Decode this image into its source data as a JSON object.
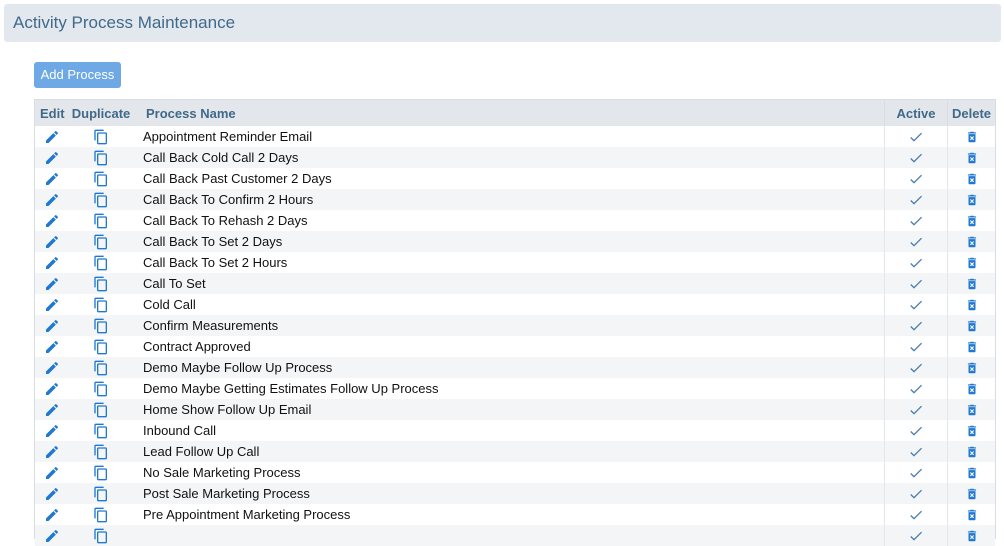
{
  "header": {
    "title": "Activity Process Maintenance"
  },
  "toolbar": {
    "add_label": "Add Process"
  },
  "table": {
    "columns": {
      "edit": "Edit",
      "duplicate": "Duplicate",
      "name": "Process Name",
      "active": "Active",
      "delete": "Delete"
    },
    "rows": [
      {
        "name": "Appointment Reminder Email",
        "active": true
      },
      {
        "name": "Call Back Cold Call 2 Days",
        "active": true
      },
      {
        "name": "Call Back Past Customer 2 Days",
        "active": true
      },
      {
        "name": "Call Back To Confirm 2 Hours",
        "active": true
      },
      {
        "name": "Call Back To Rehash 2 Days",
        "active": true
      },
      {
        "name": "Call Back To Set 2 Days",
        "active": true
      },
      {
        "name": "Call Back To Set 2 Hours",
        "active": true
      },
      {
        "name": "Call To Set",
        "active": true
      },
      {
        "name": "Cold Call",
        "active": true
      },
      {
        "name": "Confirm Measurements",
        "active": true
      },
      {
        "name": "Contract Approved",
        "active": true
      },
      {
        "name": "Demo Maybe Follow Up Process",
        "active": true
      },
      {
        "name": "Demo Maybe Getting Estimates Follow Up Process",
        "active": true
      },
      {
        "name": "Home Show Follow Up Email",
        "active": true
      },
      {
        "name": "Inbound Call",
        "active": true
      },
      {
        "name": "Lead Follow Up Call",
        "active": true
      },
      {
        "name": "No Sale Marketing Process",
        "active": true
      },
      {
        "name": "Post Sale Marketing Process",
        "active": true
      },
      {
        "name": "Pre Appointment Marketing Process",
        "active": true
      },
      {
        "name": "",
        "active": true
      }
    ]
  },
  "icons": {
    "edit": "pencil-icon",
    "duplicate": "copy-icon",
    "active": "check-icon",
    "delete": "trash-icon"
  },
  "colors": {
    "header_bg": "#e3e8ee",
    "title": "#3f6a8a",
    "button": "#6ea9e6",
    "icon_blue": "#1f78d1",
    "check": "#4a7fb0"
  }
}
